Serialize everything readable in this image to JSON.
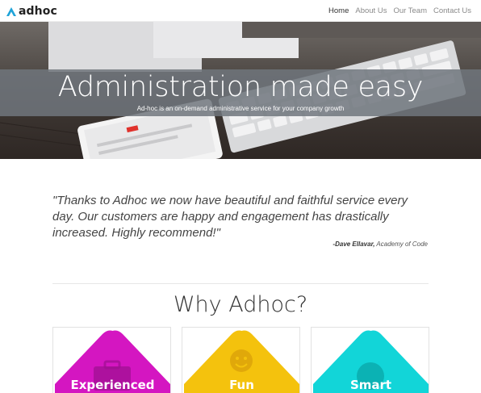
{
  "brand": {
    "name": "adhoc",
    "icon": "triangle-logo-icon",
    "color": "#1fa3d8"
  },
  "nav": {
    "items": [
      {
        "label": "Home",
        "active": true
      },
      {
        "label": "About Us",
        "active": false
      },
      {
        "label": "Our Team",
        "active": false
      },
      {
        "label": "Contact Us",
        "active": false
      }
    ]
  },
  "hero": {
    "title": "Administration made easy",
    "subtitle": "Ad-hoc is an on-demand administrative service for your company growth"
  },
  "testimonial": {
    "quote": "\"Thanks to Adhoc we now have beautiful and faithful service every day. Our customers are happy and engagement has drastically increased. Highly recommend!\"",
    "author": "-Dave Ellavar,",
    "organization": "Academy of Code"
  },
  "why": {
    "title": "Why Adhoc?",
    "cards": [
      {
        "label": "Experienced",
        "color": "#d416c1",
        "icon": "briefcase-icon"
      },
      {
        "label": "Fun",
        "color": "#f4c20d",
        "icon": "smiley-icon"
      },
      {
        "label": "Smart",
        "color": "#12d5d8",
        "icon": "bulb-icon"
      }
    ]
  }
}
